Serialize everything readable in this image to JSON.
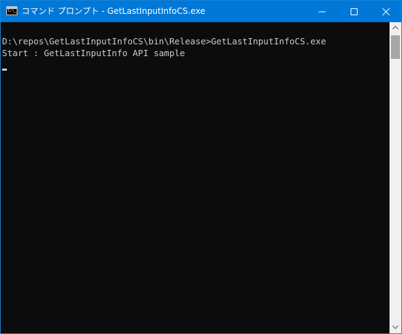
{
  "window": {
    "title": "コマンド プロンプト - GetLastInputInfoCS.exe",
    "app_icon_text": "C:\\_",
    "title_bar_color": "#0078d7",
    "console_background": "#0c0c0c",
    "console_text_color": "#cccccc"
  },
  "controls": {
    "minimize_icon": "minimize-icon",
    "maximize_icon": "maximize-icon",
    "close_icon": "close-icon"
  },
  "console": {
    "lines": [
      "D:\\repos\\GetLastInputInfoCS\\bin\\Release>GetLastInputInfoCS.exe",
      "Start : GetLastInputInfo API sample"
    ]
  }
}
